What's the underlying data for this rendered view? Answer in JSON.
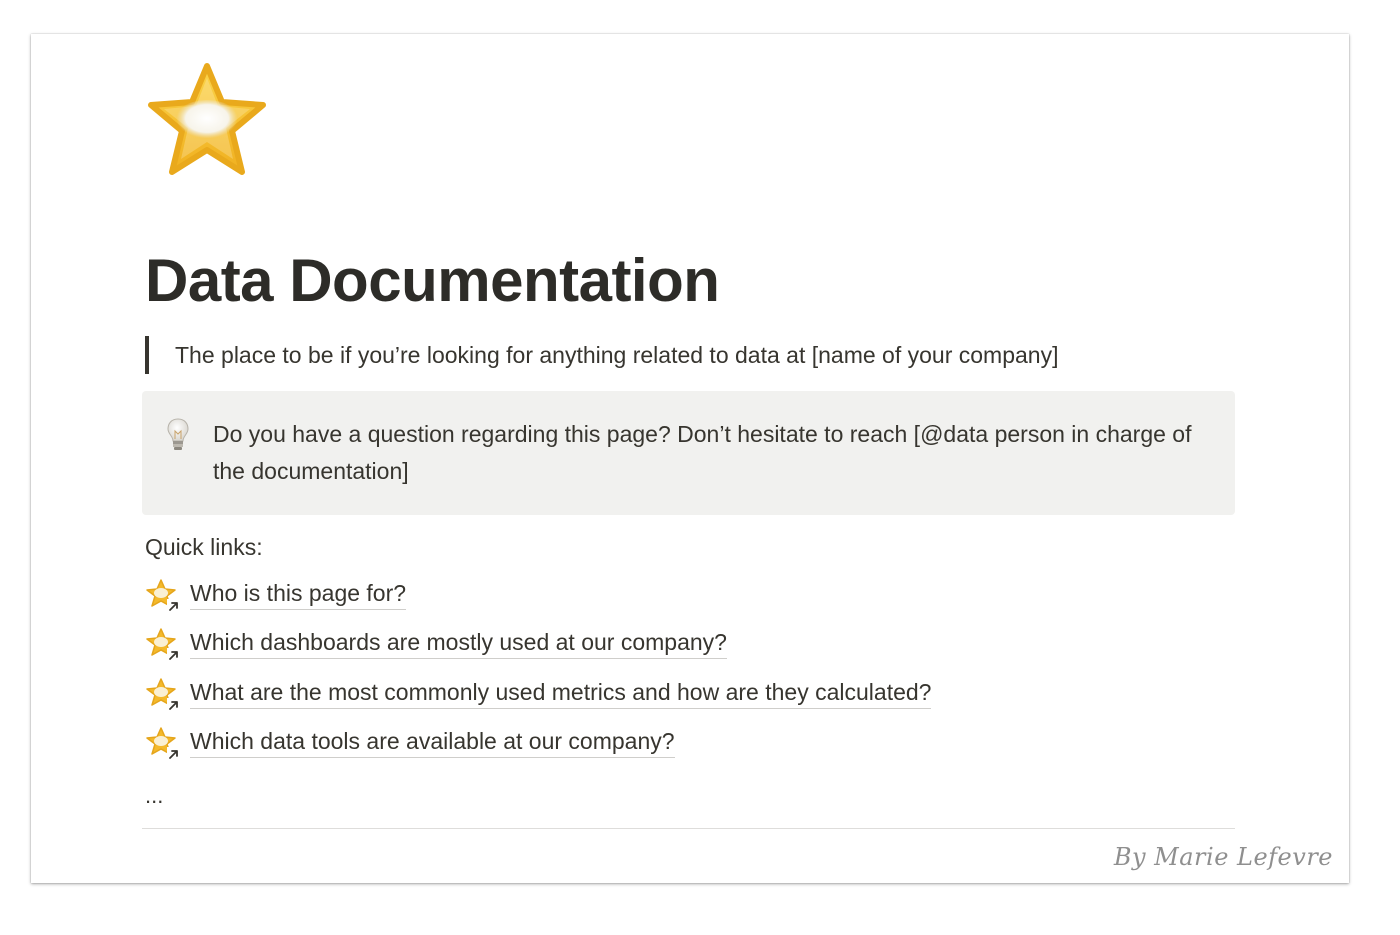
{
  "page": {
    "icon": "star-icon",
    "title": "Data Documentation",
    "quote": "The place to be if you’re looking for anything related to data at [name of your company]",
    "callout": {
      "icon": "lightbulb-icon",
      "text": "Do you have a question regarding this page? Don’t hesitate to reach [@data person in charge of the documentation]"
    },
    "quick_links_label": "Quick links:",
    "links": [
      {
        "icon": "star-link-icon",
        "label": "Who is this page for?"
      },
      {
        "icon": "star-link-icon",
        "label": "Which dashboards are mostly used at our company?"
      },
      {
        "icon": "star-link-icon",
        "label": "What are the most commonly used metrics and how are they calculated?"
      },
      {
        "icon": "star-link-icon",
        "label": "Which data tools are available at our company?"
      }
    ],
    "ellipsis": "...",
    "signature": "By Marie Lefevre"
  },
  "colors": {
    "text": "#37352f",
    "title": "#2d2c28",
    "callout_bg": "#f1f1ef",
    "star_gold": "#f4b92b",
    "divider": "#dedddb",
    "signature": "#8f8f8f"
  }
}
